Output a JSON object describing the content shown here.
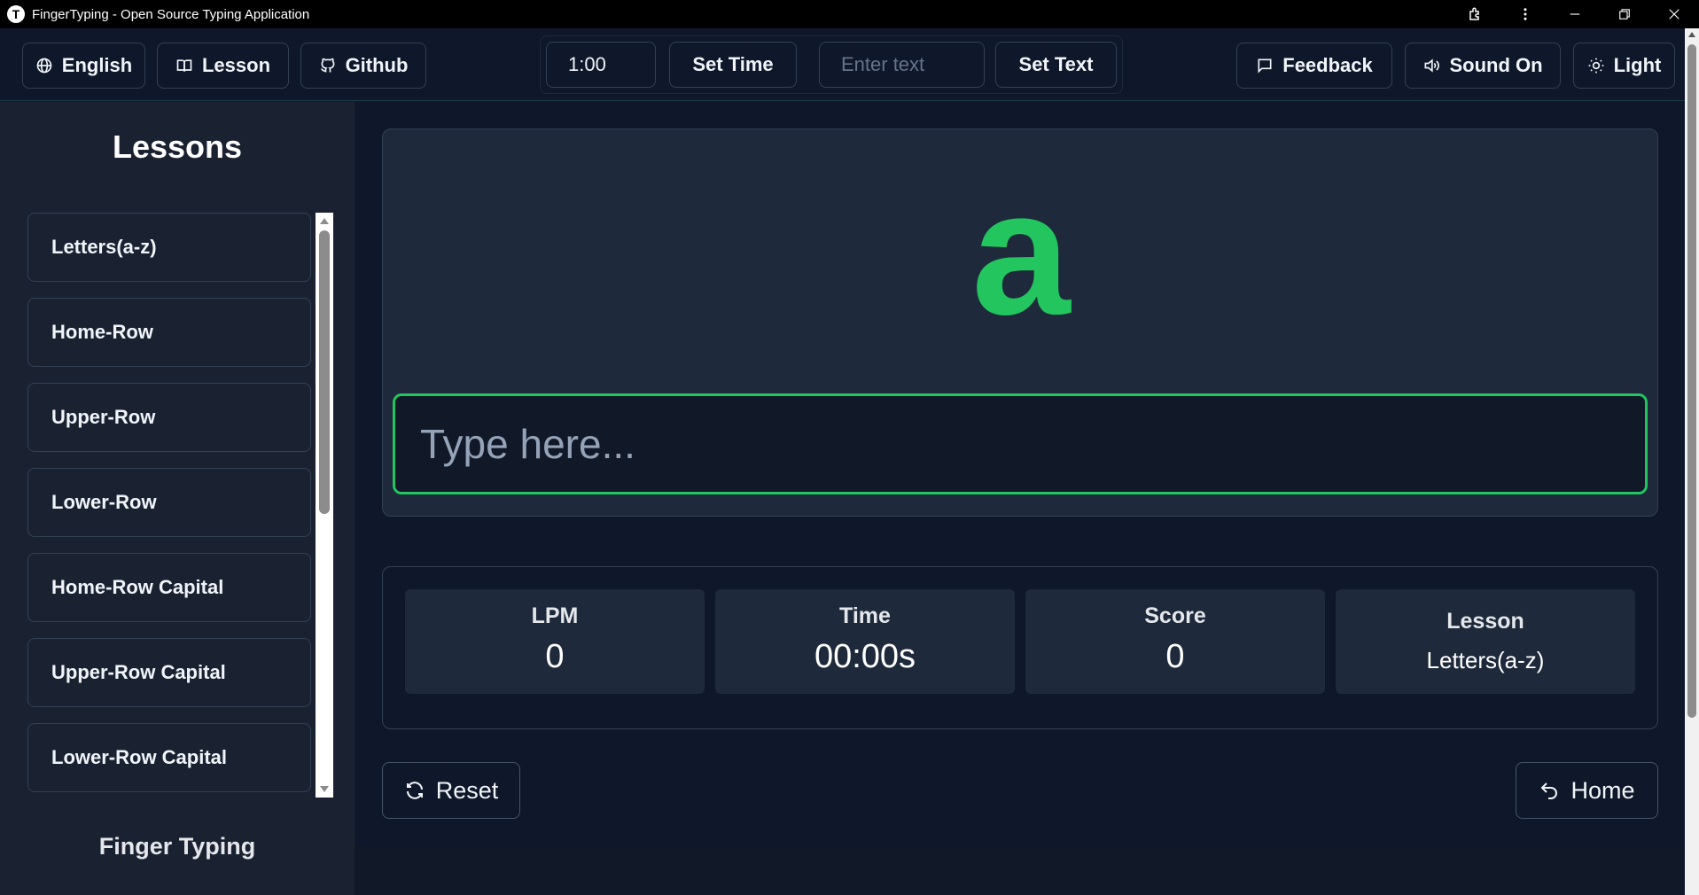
{
  "window": {
    "title": "FingerTyping - Open Source Typing Application",
    "app_icon_letter": "T"
  },
  "toolbar": {
    "language_label": "English",
    "lesson_label": "Lesson",
    "github_label": "Github",
    "time_value": "1:00",
    "set_time_label": "Set Time",
    "text_placeholder": "Enter text",
    "set_text_label": "Set Text",
    "feedback_label": "Feedback",
    "sound_label": "Sound On",
    "theme_label": "Light"
  },
  "sidebar": {
    "title": "Lessons",
    "items": [
      {
        "label": "Letters(a-z)"
      },
      {
        "label": "Home-Row"
      },
      {
        "label": "Upper-Row"
      },
      {
        "label": "Lower-Row"
      },
      {
        "label": "Home-Row Capital"
      },
      {
        "label": "Upper-Row Capital"
      },
      {
        "label": "Lower-Row Capital"
      }
    ],
    "footer": "Finger Typing"
  },
  "typing": {
    "current_char": "a",
    "input_placeholder": "Type here...",
    "accent_color": "#22c55e"
  },
  "stats": {
    "lpm": {
      "label": "LPM",
      "value": "0"
    },
    "time": {
      "label": "Time",
      "value": "00:00s"
    },
    "score": {
      "label": "Score",
      "value": "0"
    },
    "lesson": {
      "label": "Lesson",
      "value": "Letters(a-z)"
    }
  },
  "actions": {
    "reset_label": "Reset",
    "home_label": "Home"
  }
}
